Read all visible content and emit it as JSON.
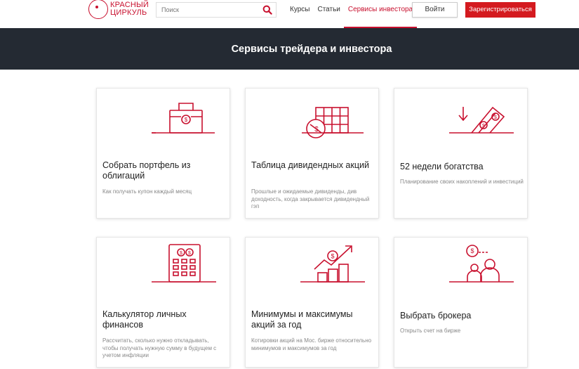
{
  "header": {
    "logo_line1": "КРАСНЫЙ",
    "logo_line2": "ЦИРКУЛЬ",
    "search_placeholder": "Поиск",
    "nav": [
      "Курсы",
      "Статьи",
      "Сервисы инвестора"
    ],
    "login_label": "Войти",
    "register_label": "Зарегистрироваться"
  },
  "banner": {
    "title": "Сервисы трейдера и инвестора"
  },
  "cards": [
    {
      "title": "Собрать портфель из облигаций",
      "desc": "Как получать купон каждый месяц",
      "icon": "briefcase-icon"
    },
    {
      "title": "Таблица дивидендных акций",
      "desc": "Прошлые и ожидаемые дивиденды, див доходность, когда закрывается дивидендный гэп",
      "icon": "table-coin-icon"
    },
    {
      "title": "52 недели богатства",
      "desc": "Планирование своих накоплений и инвестиций",
      "icon": "money-arrow-icon"
    },
    {
      "title": "Калькулятор личных финансов",
      "desc": "Рассчитать, сколько нужно откладывать, чтобы получать нужную сумму в будущем с учетом инфляции",
      "icon": "calculator-icon"
    },
    {
      "title": "Минимумы и максимумы акций за год",
      "desc": "Котировки акций на Мос. бирже относительно минимумов и максимумов за год",
      "icon": "growth-chart-icon"
    },
    {
      "title": "Выбрать брокера",
      "desc": "Открыть счет на бирже",
      "icon": "broker-people-icon"
    }
  ],
  "colors": {
    "accent": "#c8102e",
    "banner_bg": "#242a33"
  }
}
